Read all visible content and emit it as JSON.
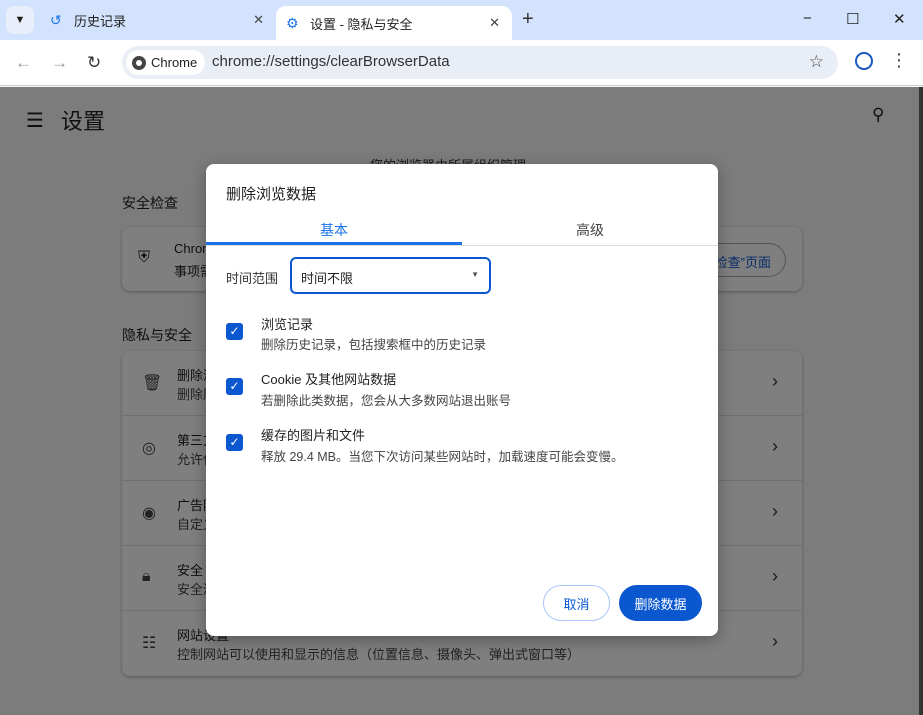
{
  "tabs": [
    {
      "title": "历史记录",
      "icon": "history-icon"
    },
    {
      "title": "设置 - 隐私与安全",
      "icon": "gear-icon"
    }
  ],
  "omnibox": {
    "chip": "Chrome",
    "url": "chrome://settings/clearBrowserData"
  },
  "settings": {
    "title": "设置",
    "managed": "您的浏览器由所属组织管理",
    "safety_heading": "安全检查",
    "safety_card": {
      "line1": "Chrom",
      "line2": "事项需",
      "button": "检查”页面"
    },
    "privacy_heading": "隐私与安全",
    "rows": [
      {
        "icon": "trash-icon",
        "t1": "删除浏",
        "t2": "删除历"
      },
      {
        "icon": "cookie-icon",
        "t1": "第三方",
        "t2": "允许使"
      },
      {
        "icon": "ad-privacy-icon",
        "t1": "广告隐",
        "t2": "自定义"
      },
      {
        "icon": "lock-icon",
        "t1": "安全",
        "t2": "安全浏"
      },
      {
        "icon": "tune-icon",
        "t1": "网站设置",
        "t2": "控制网站可以使用和显示的信息（位置信息、摄像头、弹出式窗口等）"
      }
    ]
  },
  "dialog": {
    "title": "删除浏览数据",
    "tabs": [
      "基本",
      "高级"
    ],
    "time_range_label": "时间范围",
    "time_range_value": "时间不限",
    "items": [
      {
        "title": "浏览记录",
        "desc": "删除历史记录，包括搜索框中的历史记录",
        "checked": true
      },
      {
        "title": "Cookie 及其他网站数据",
        "desc": "若删除此类数据，您会从大多数网站退出账号",
        "checked": true
      },
      {
        "title": "缓存的图片和文件",
        "desc": "释放 29.4 MB。当您下次访问某些网站时，加载速度可能会变慢。",
        "checked": true
      }
    ],
    "cancel": "取消",
    "confirm": "删除数据"
  },
  "colors": {
    "accent": "#0b57d0",
    "titlebar": "#d3e3fd"
  }
}
